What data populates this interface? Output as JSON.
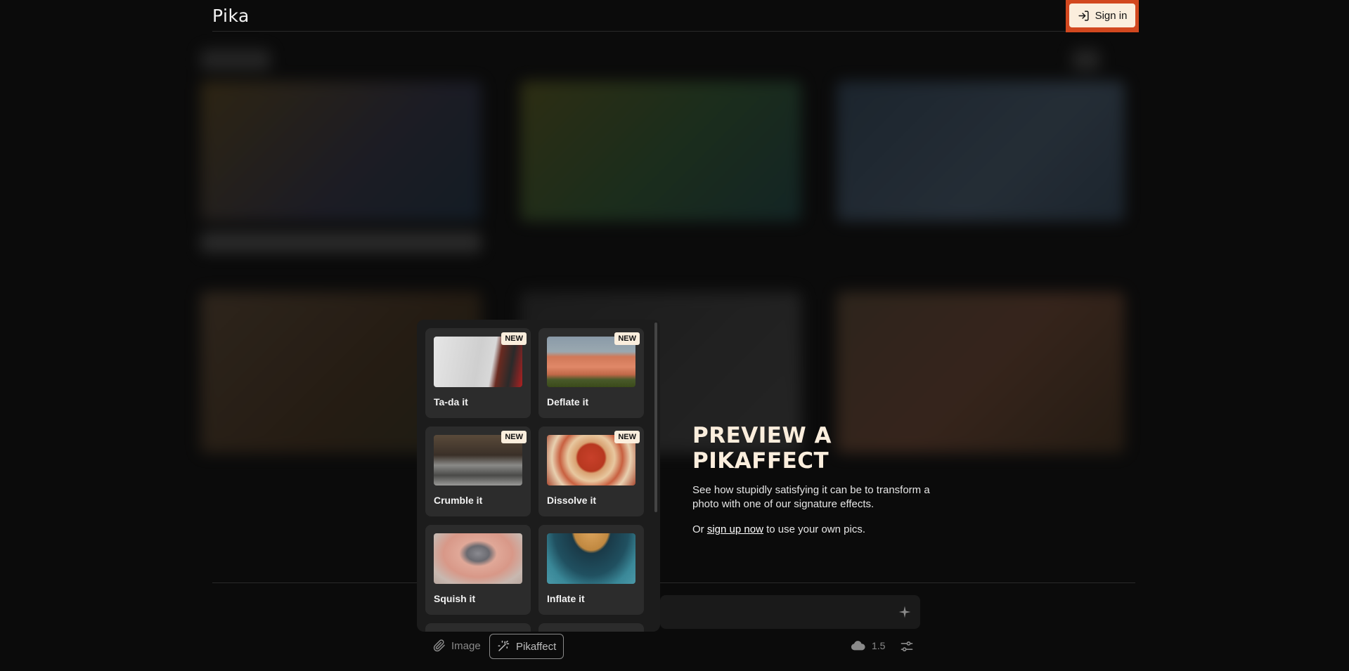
{
  "app": {
    "logo": "Pika"
  },
  "header": {
    "signin_label": "Sign in",
    "signin_highlight": "#d2481f"
  },
  "pikaffects": [
    {
      "label": "Ta-da it",
      "badge": "NEW",
      "thumb": "cloth-reveal"
    },
    {
      "label": "Deflate it",
      "badge": "NEW",
      "thumb": "bread-loaf"
    },
    {
      "label": "Crumble it",
      "badge": "NEW",
      "thumb": "crumbling-figures"
    },
    {
      "label": "Dissolve it",
      "badge": "NEW",
      "thumb": "red-plate"
    },
    {
      "label": "Squish it",
      "badge": "",
      "thumb": "hands-squishing"
    },
    {
      "label": "Inflate it",
      "badge": "",
      "thumb": "inflating-object"
    }
  ],
  "preview": {
    "title_line1": "PREVIEW A",
    "title_line2": "PIKAFFECT",
    "description": "See how stupidly satisfying it can be to transform a photo with one of our signature effects.",
    "or_prefix": "Or",
    "signup_link": "sign up now",
    "or_suffix": "to use your own pics."
  },
  "toolbar": {
    "image_label": "Image",
    "pikaffect_label": "Pikaffect",
    "model_version": "1.5"
  },
  "icons": [
    "sign-in-icon",
    "paperclip-icon",
    "magic-wand-icon",
    "cloud-icon",
    "settings-sliders-icon",
    "sparkle-icon"
  ]
}
